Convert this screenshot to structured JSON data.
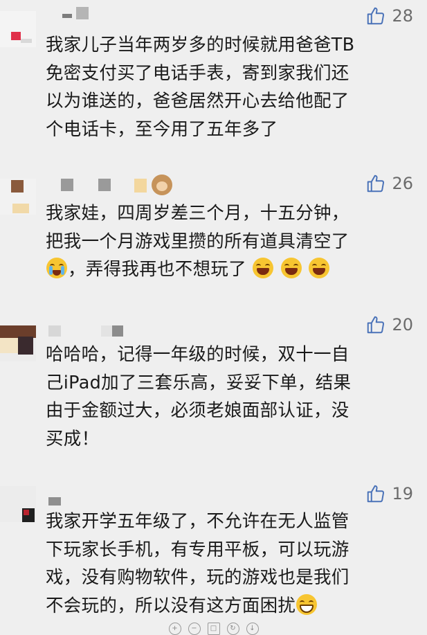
{
  "colors": {
    "background": "#efefef",
    "like_icon": "#4a72b8",
    "like_count": "#6b6b6b",
    "text": "#1a1a1a"
  },
  "comments": [
    {
      "likes": "28",
      "text": "我家儿子当年两岁多的时候就用爸爸TB免密支付买了电话手表，寄到家我们还以为谁送的，爸爸居然开心去给他配了个电话卡，至今用了五年多了",
      "lines": [
        "我家儿子当年两岁多的时候就用爸爸TB",
        "免密支付买了电话手表，寄到家我们还",
        "以为谁送的，爸爸居然开心去给他配了",
        "个电话卡，至今用了五年多了"
      ]
    },
    {
      "likes": "26",
      "lines": [
        "我家娃，四周岁差三个月，十五分钟，",
        "把我一个月游戏里攒的所有道具清空了",
        "，弄得我再也不想玩了"
      ],
      "emojis": [
        "crying-face",
        "laughing-face",
        "laughing-face",
        "laughing-face"
      ]
    },
    {
      "likes": "20",
      "lines": [
        "哈哈哈，记得一年级的时候，双十一自",
        "己iPad加了三套乐高，妥妥下单，结果",
        "由于金额过大，必须老娘面部认证，没",
        "买成！"
      ]
    },
    {
      "likes": "19",
      "lines": [
        "我家开学五年级了，不允许在无人监管",
        "下玩家长手机，有专用平板，可以玩游",
        "戏，没有购物软件，玩的游戏也是我们",
        "不会玩的，所以没有这方面困扰"
      ],
      "emojis": [
        "grinning-face"
      ]
    }
  ]
}
